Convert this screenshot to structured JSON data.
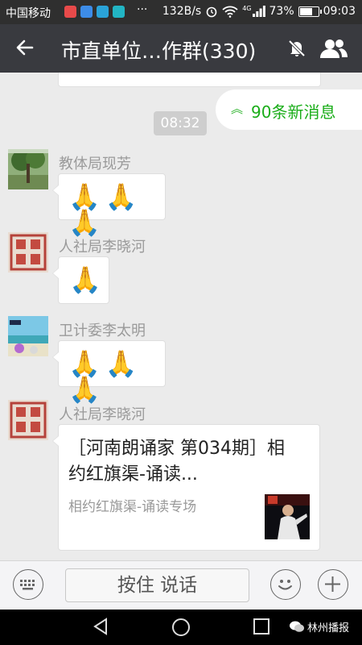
{
  "status_bar": {
    "carrier": "中国移动",
    "app_icon_colors": [
      "#e84a4a",
      "#3d8ce8",
      "#2aa3d8",
      "#22b5c4"
    ],
    "more": "···",
    "speed": "132B/s",
    "network": "4G",
    "battery": "73%",
    "battery_level": 0.73,
    "time": "09:03"
  },
  "header": {
    "title": "市直单位…作群(330)",
    "back_icon": "back-arrow-icon",
    "mute_icon": "mute-bell-icon",
    "members_icon": "members-icon"
  },
  "chat": {
    "new_messages": "90条新消息",
    "timestamp": "08:32",
    "messages": [
      {
        "sender": "教体局现芳",
        "content": "🙏🙏🙏"
      },
      {
        "sender": "人社局李晓河",
        "content": "🙏"
      },
      {
        "sender": "卫计委李太明",
        "content": "🙏🙏🙏"
      },
      {
        "sender": "人社局李晓河",
        "card_title": "［河南朗诵家 第034期］相约红旗渠-诵读...",
        "card_subtitle": "相约红旗渠-诵读专场"
      }
    ],
    "accent_color": "#1aad19"
  },
  "input_bar": {
    "talk_label": "按住 说话"
  },
  "watermark": "林州播报"
}
